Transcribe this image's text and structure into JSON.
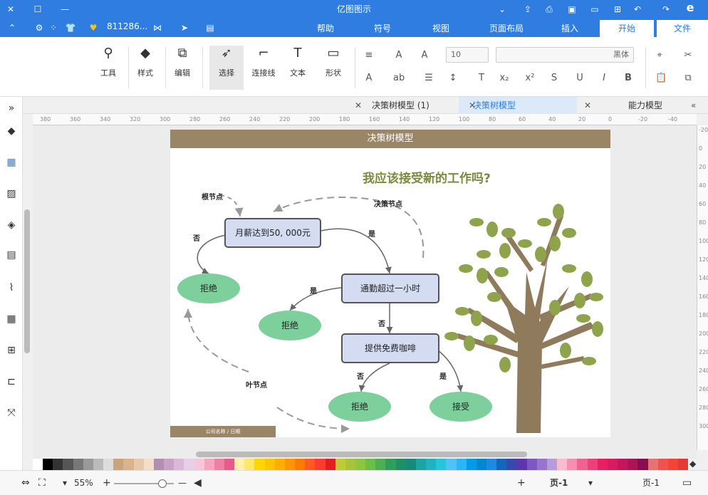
{
  "app": {
    "title": "亿图图示",
    "account": "811286...",
    "menus": [
      "文件",
      "开始",
      "插入",
      "页面布局",
      "视图",
      "符号",
      "帮助"
    ]
  },
  "ribbon": {
    "tools": [
      "工具",
      "样式",
      "编辑",
      "选择",
      "连接线",
      "文本",
      "形状"
    ],
    "font_name": "黑体",
    "font_size": "10"
  },
  "tabs": [
    {
      "label": "能力模型"
    },
    {
      "label": "决策树模型"
    },
    {
      "label": "决策树模型 (1)"
    }
  ],
  "ruler": {
    "h_ticks": [
      "-40",
      "-20",
      "0",
      "20",
      "40",
      "60",
      "80",
      "100",
      "120",
      "140",
      "160",
      "180",
      "200",
      "220",
      "240",
      "260",
      "280",
      "300",
      "320",
      "340",
      "360",
      "380"
    ],
    "v_ticks": [
      "-20",
      "0",
      "20",
      "40",
      "60",
      "80",
      "100",
      "120",
      "140",
      "160",
      "180",
      "200",
      "220",
      "240",
      "260",
      "280",
      "300"
    ]
  },
  "diagram": {
    "header": "决策树模型",
    "question": "我应该接受新的工作吗?",
    "nodes": {
      "salary": "月薪达到50, 000元",
      "commute": "通勤超过一小时",
      "coffee": "提供免费咖啡",
      "reject1": "拒绝",
      "reject2": "拒绝",
      "reject3": "拒绝",
      "accept": "接受"
    },
    "labels": {
      "root_node": "根节点",
      "decision_node": "决策节点",
      "leaf_node": "叶节点",
      "yes1": "是",
      "no1": "否",
      "yes2": "是",
      "no2": "否",
      "yes3": "是",
      "no3": "否"
    },
    "footer": "公司名称 / 日期"
  },
  "status": {
    "page_current": "页-1",
    "page_tab": "页-1",
    "add": "+",
    "zoom": "55%"
  },
  "colors": {
    "accent": "#2f7de1",
    "header": "#9a8567",
    "node_fill": "#d4dcf2",
    "leaf_fill": "#7dcf9c",
    "question": "#7a8b3d",
    "palette": [
      "#ffffff",
      "#000000",
      "#333333",
      "#555555",
      "#777777",
      "#999999",
      "#bbbbbb",
      "#dddddd",
      "#c9a27e",
      "#d9b38c",
      "#e6c9a8",
      "#f2dfc8",
      "#b08fb0",
      "#c7a3c7",
      "#d9b8d9",
      "#e8cfe8",
      "#f7c6d9",
      "#f4a6c0",
      "#ef7fa3",
      "#e85a8a",
      "#fff2a8",
      "#ffe866",
      "#ffd700",
      "#ffc400",
      "#ffae00",
      "#ff9500",
      "#ff7a00",
      "#ff5a1f",
      "#ff3b30",
      "#e02020",
      "#c0ca33",
      "#a8c23a",
      "#8cc63f",
      "#6cbf45",
      "#4caf50",
      "#2e9e5b",
      "#1f8f66",
      "#178a78",
      "#1aa5a0",
      "#20b2c0",
      "#26c6da",
      "#4fc3f7",
      "#29b6f6",
      "#039be5",
      "#0288d1",
      "#1e88e5",
      "#1565c0",
      "#3949ab",
      "#5e35b1",
      "#7e57c2",
      "#9575cd",
      "#b39ddb",
      "#f8bbd0",
      "#f48fb1",
      "#f06292",
      "#ec407a",
      "#e91e63",
      "#d81b60",
      "#c2185b",
      "#ad1457",
      "#880e4f",
      "#e57373",
      "#ef5350",
      "#f44336",
      "#e53935"
    ]
  }
}
